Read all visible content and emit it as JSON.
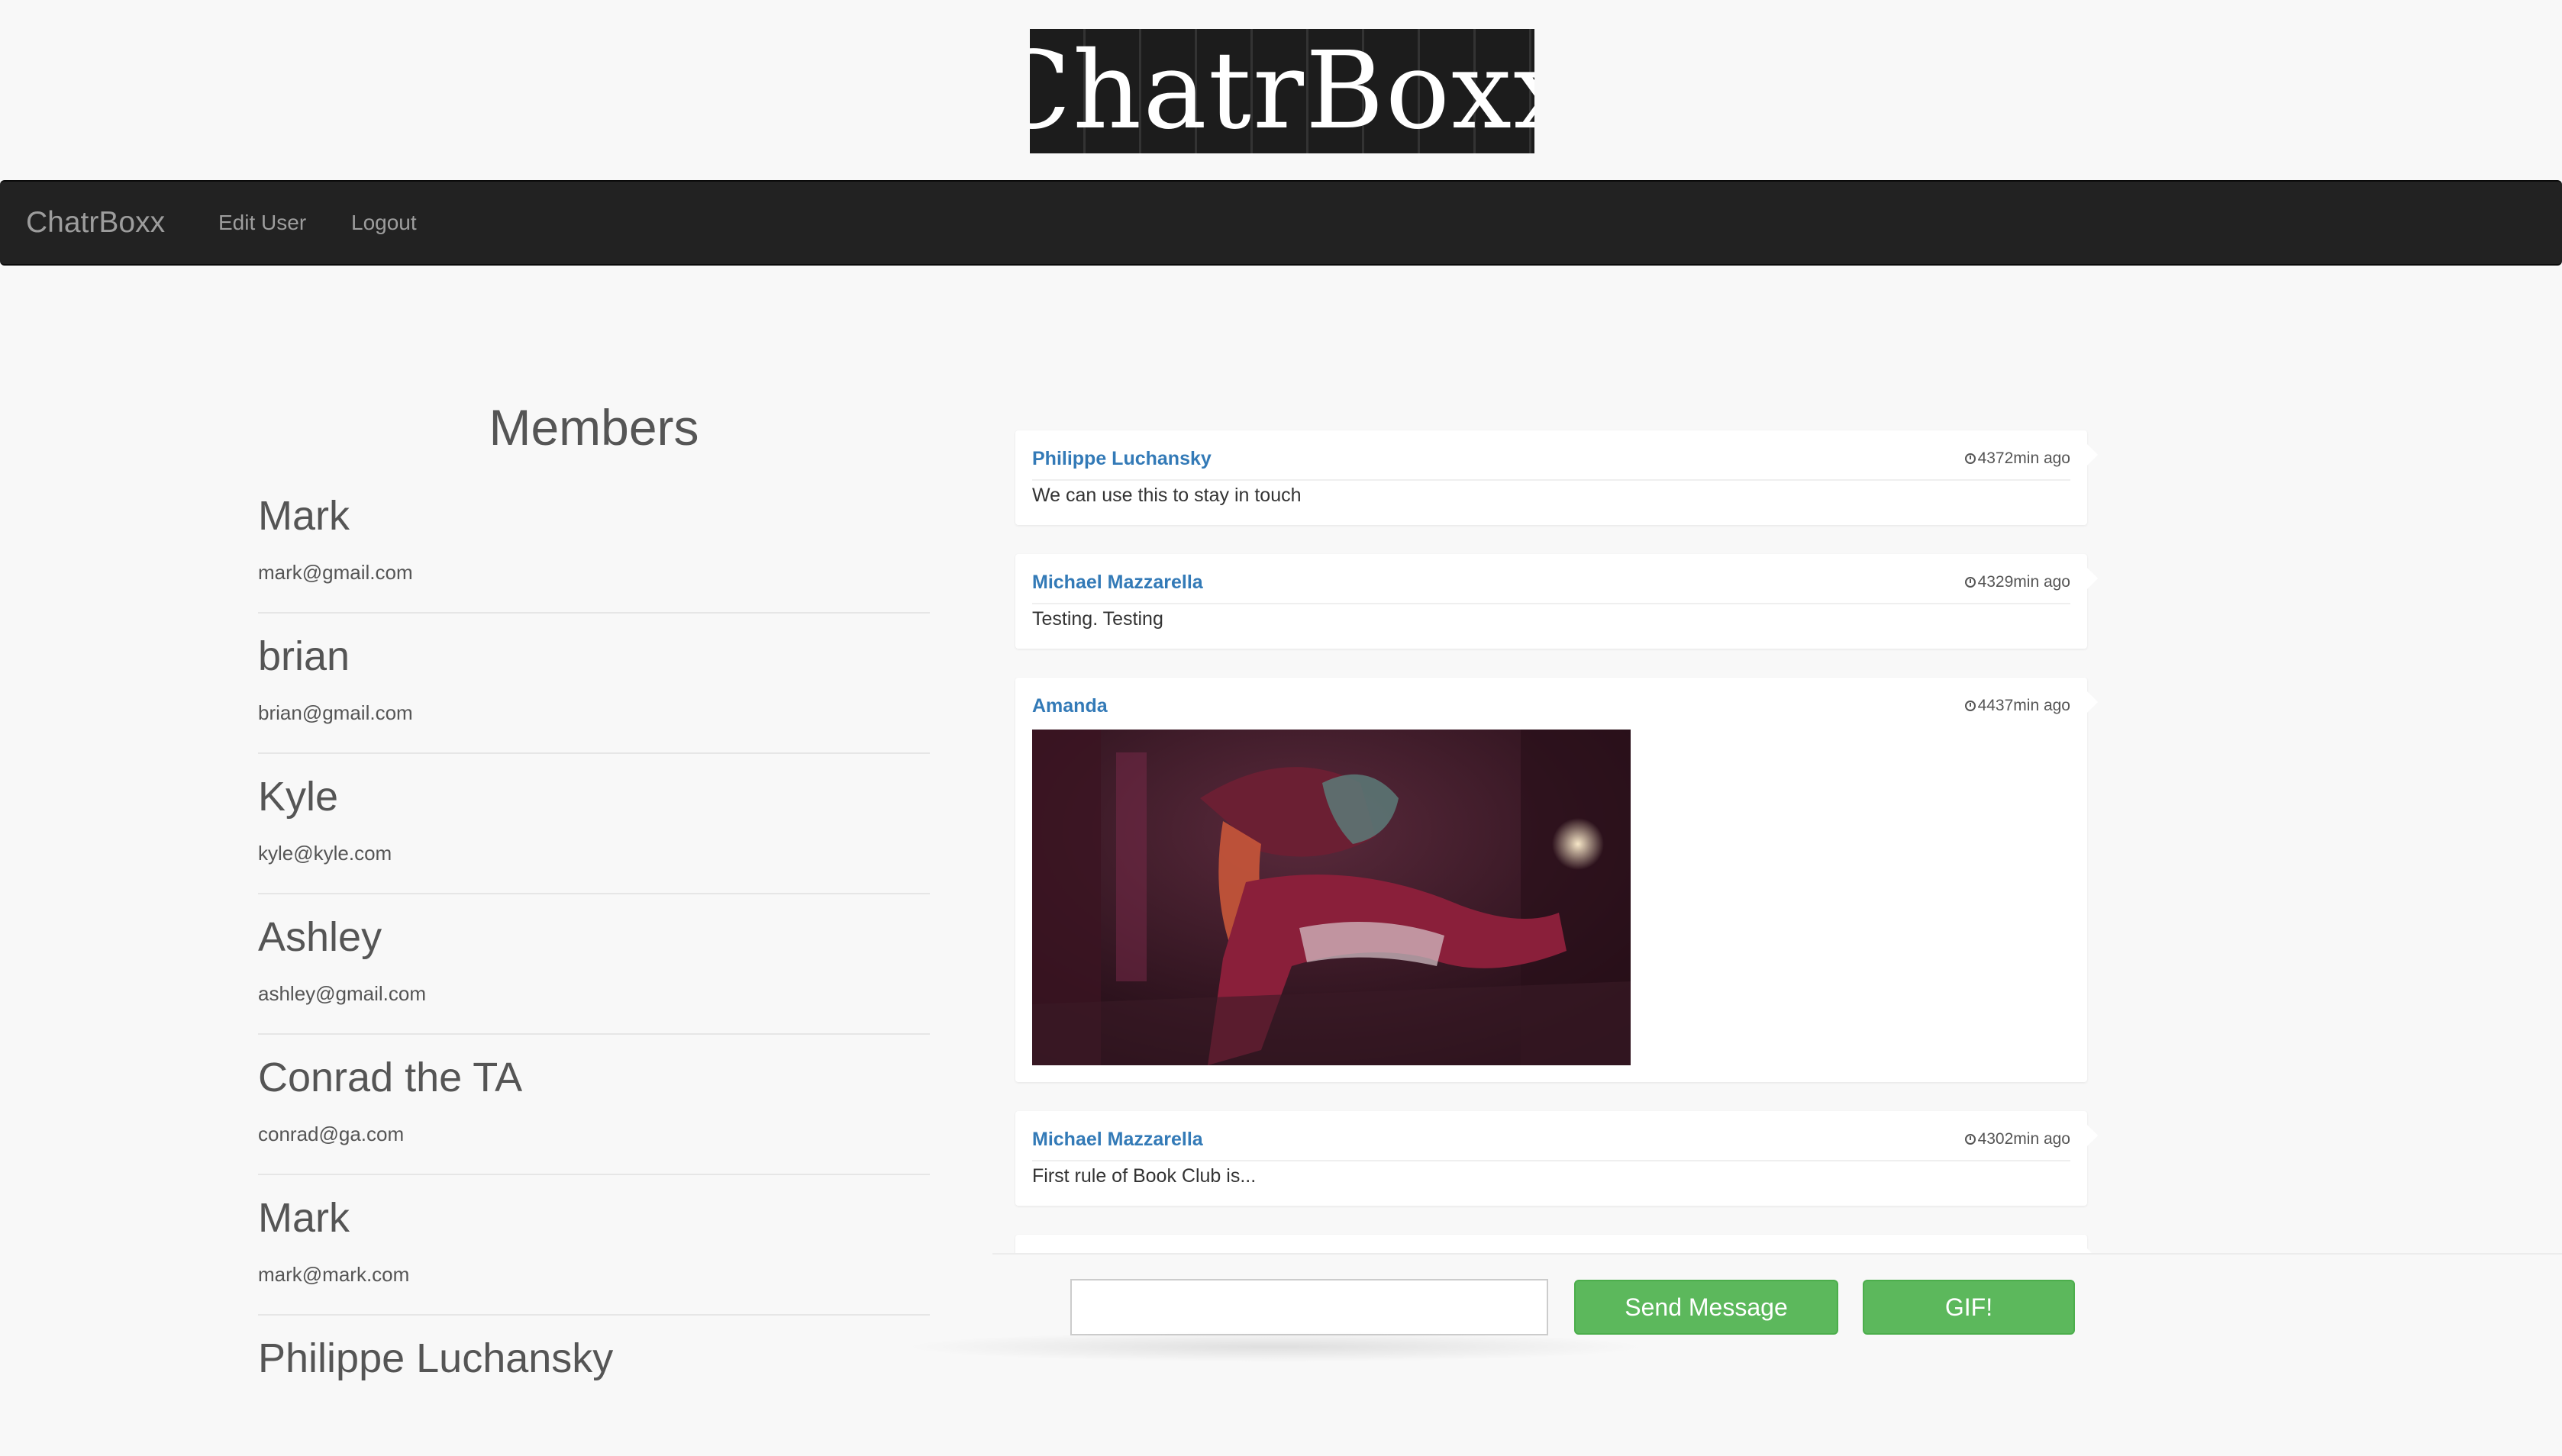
{
  "logo": {
    "text": "ChatrBoxx"
  },
  "navbar": {
    "brand": "ChatrBoxx",
    "links": [
      "Edit User",
      "Logout"
    ]
  },
  "members": {
    "title": "Members",
    "items": [
      {
        "name": "Mark",
        "email": "mark@gmail.com"
      },
      {
        "name": "brian",
        "email": "brian@gmail.com"
      },
      {
        "name": "Kyle",
        "email": "kyle@kyle.com"
      },
      {
        "name": "Ashley",
        "email": "ashley@gmail.com"
      },
      {
        "name": "Conrad the TA",
        "email": "conrad@ga.com"
      },
      {
        "name": "Mark",
        "email": "mark@mark.com"
      },
      {
        "name": "Philippe Luchansky",
        "email": ""
      }
    ]
  },
  "messages": [
    {
      "author": "Philippe Luchansky",
      "time": "4372min ago",
      "text": "We can use this to stay in touch"
    },
    {
      "author": "Michael Mazzarella",
      "time": "4329min ago",
      "text": "Testing. Testing"
    },
    {
      "author": "Amanda",
      "time": "4437min ago",
      "text": ""
    },
    {
      "author": "Michael Mazzarella",
      "time": "4302min ago",
      "text": "First rule of Book Club is..."
    }
  ],
  "composer": {
    "input_value": "",
    "input_placeholder": "",
    "send_label": "Send Message",
    "gif_label": "GIF!"
  },
  "colors": {
    "navbar_bg": "#222222",
    "link_blue": "#337ab7",
    "button_green": "#5cb85c",
    "page_bg": "#f8f8f8"
  }
}
